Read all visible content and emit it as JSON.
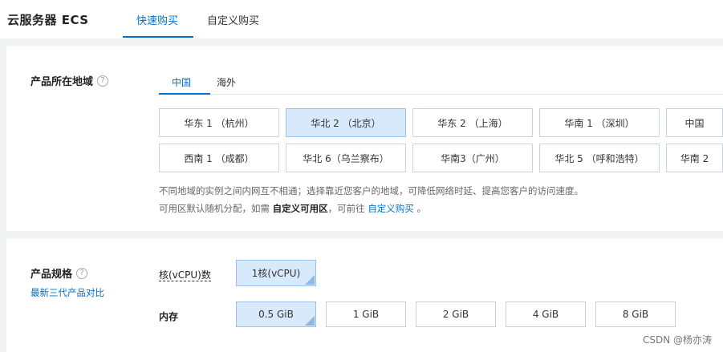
{
  "header": {
    "title": "云服务器 ECS",
    "tabs": [
      {
        "label": "快速购买",
        "active": true
      },
      {
        "label": "自定义购买",
        "active": false
      }
    ]
  },
  "region_section": {
    "label": "产品所在地域",
    "help_icon": "question-circle-icon",
    "subtabs": [
      {
        "label": "中国",
        "active": true
      },
      {
        "label": "海外",
        "active": false
      }
    ],
    "regions_row1": [
      "华东 1 （杭州）",
      "华北 2 （北京）",
      "华东 2 （上海）",
      "华南 1 （深圳）",
      "中国"
    ],
    "regions_row2": [
      "西南 1 （成都）",
      "华北 6（乌兰察布）",
      "华南3（广州）",
      "华北 5 （呼和浩特）",
      "华南 2"
    ],
    "selected_region": "华北 2 （北京）",
    "note1": "不同地域的实例之间内网互不相通；选择靠近您客户的地域，可降低网络时延、提高您客户的访问速度。",
    "note2_prefix": "可用区默认随机分配，如需 ",
    "note2_bold": "自定义可用区",
    "note2_mid": "，可前往 ",
    "note2_link": "自定义购买",
    "note2_suffix": " 。"
  },
  "spec_section": {
    "label": "产品规格",
    "help_icon": "question-circle-icon",
    "compare_link": "最新三代产品对比",
    "vcpu_label": "核(vCPU)数",
    "vcpu_options": [
      "1核(vCPU)"
    ],
    "memory_label": "内存",
    "memory_options": [
      "0.5 GiB",
      "1 GiB",
      "2 GiB",
      "4 GiB",
      "8 GiB"
    ],
    "selected_vcpu": "1核(vCPU)",
    "selected_memory": "0.5 GiB"
  },
  "watermark": "CSDN @杨亦涛",
  "colors": {
    "accent": "#0070cc",
    "selected_bg": "#d8e9fb",
    "selected_border": "#9cc3ea"
  }
}
